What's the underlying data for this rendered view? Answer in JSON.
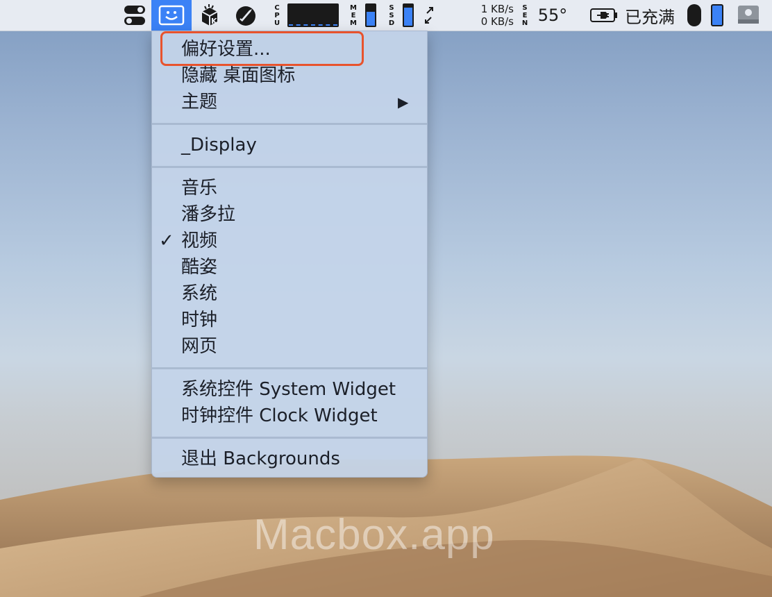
{
  "menubar": {
    "cpu_label": [
      "C",
      "P",
      "U"
    ],
    "mem_label": [
      "M",
      "E",
      "M"
    ],
    "ssd_label": [
      "S",
      "S",
      "D"
    ],
    "sen_label": [
      "S",
      "E",
      "N"
    ],
    "net_up": "1 KB/s",
    "net_down": "0 KB/s",
    "temperature": "55°",
    "battery_status": "已充满",
    "icons": [
      "toggle-icon",
      "smiley-icon",
      "k-box-icon",
      "rocket-icon",
      "cpu-graph",
      "mem-bar",
      "ssd-bar",
      "arrows-icon",
      "battery-plug-icon",
      "mouse-icon",
      "phone-battery-icon",
      "disk-icon"
    ]
  },
  "menu": {
    "preferences": "偏好设置...",
    "hide_desktop_icons": "隐藏 桌面图标",
    "theme": "主题",
    "submenu_arrow": "▶",
    "display": "_Display",
    "categories": [
      "音乐",
      "潘多拉",
      "视频",
      "酷姿",
      "系统",
      "时钟",
      "网页"
    ],
    "checked_category": "视频",
    "checkmark": "✓",
    "system_widget": "系统控件 System Widget",
    "clock_widget": "时钟控件 Clock Widget",
    "quit": "退出 Backgrounds"
  },
  "watermark": "Macbox.app",
  "colors": {
    "highlight": "#e8532d",
    "menubar_active": "#3b82f6"
  }
}
